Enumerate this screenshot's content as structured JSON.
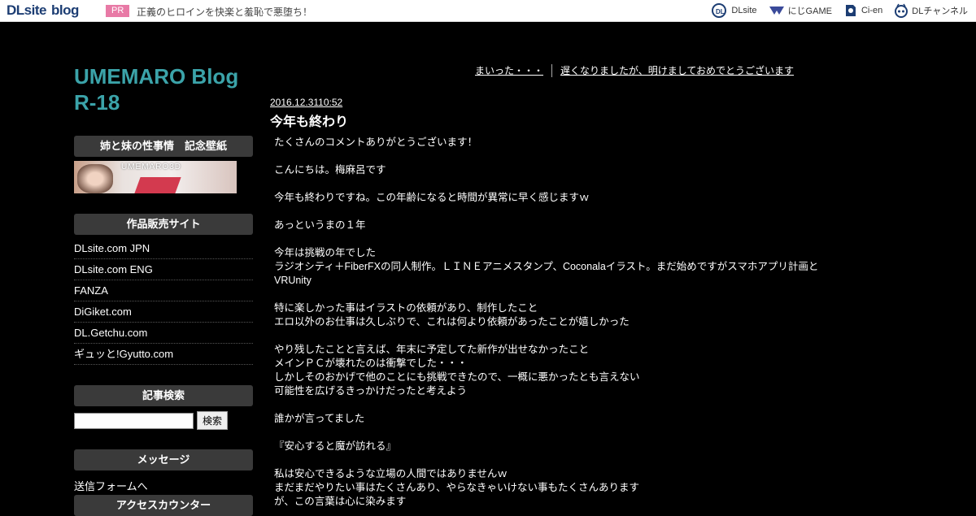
{
  "topbar": {
    "logo_main": "DLsite",
    "logo_blog": "blog",
    "pr_label": "PR",
    "pr_text": "正義のヒロインを快楽と羞恥で悪堕ち！",
    "links": [
      {
        "label": "DLsite",
        "icon": "dlsite-icon"
      },
      {
        "label": "にじGAME",
        "icon": "nijigame-icon"
      },
      {
        "label": "Ci-en",
        "icon": "ci-en-icon"
      },
      {
        "label": "DLチャンネル",
        "icon": "dlchannel-icon"
      }
    ]
  },
  "blog": {
    "title": "UMEMARO Blog R-18"
  },
  "sidebar": {
    "wallpaper_head": "姉と妹の性事情　記念壁紙",
    "banner_text": "UMEMARO3D",
    "shops_head": "作品販売サイト",
    "shops": [
      "DLsite.com JPN",
      "DLsite.com ENG",
      "FANZA",
      "DiGiket.com",
      "DL.Getchu.com",
      "ギュッと!Gyutto.com"
    ],
    "search_head": "記事検索",
    "search_button": "検索",
    "search_value": "",
    "message_head": "メッセージ",
    "message_link": "送信フォームへ",
    "counter_head": "アクセスカウンター"
  },
  "nav": {
    "prev": "まいった・・・",
    "next": "遅くなりましたが、明けましておめでとうございます"
  },
  "post": {
    "date": "2016.12.3110:52",
    "title": "今年も終わり",
    "paragraphs": [
      "たくさんのコメントありがとうございます！",
      "こんにちは。梅麻呂です",
      "今年も終わりですね。この年齢になると時間が異常に早く感じますｗ",
      "あっというまの１年",
      "今年は挑戦の年でした\nラジオシティ＋FiberFXの同人制作。ＬＩＮＥアニメスタンプ、Coconalaイラスト。まだ始めですがスマホアプリ計画とVRUnity",
      "特に楽しかった事はイラストの依頼があり、制作したこと\nエロ以外のお仕事は久しぶりで、これは何より依頼があったことが嬉しかった",
      "やり残したことと言えば、年末に予定してた新作が出せなかったこと\nメインＰＣが壊れたのは衝撃でした・・・\nしかしそのおかげで他のことにも挑戦できたので、一概に悪かったとも言えない\n可能性を広げるきっかけだったと考えよう",
      "誰かが言ってました",
      "『安心すると魔が訪れる』",
      "私は安心できるような立場の人間ではありませんｗ\nまだまだやりたい事はたくさんあり、やらなきゃいけない事もたくさんあります\nが、この言葉は心に染みます"
    ]
  }
}
